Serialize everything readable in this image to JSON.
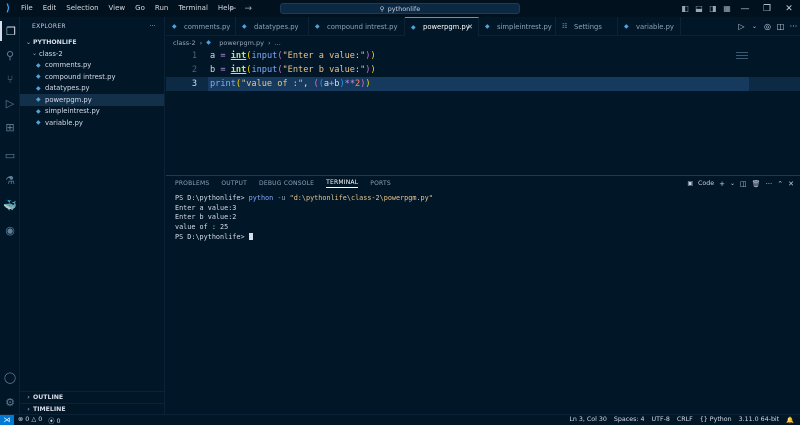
{
  "titlebar": {
    "menu": [
      "File",
      "Edit",
      "Selection",
      "View",
      "Go",
      "Run",
      "Terminal",
      "Help"
    ],
    "search_text": "pythonlife"
  },
  "explorer": {
    "title": "EXPLORER",
    "workspace": "PYTHONLIFE",
    "folder": "class-2",
    "files": [
      "comments.py",
      "compound intrest.py",
      "datatypes.py",
      "powerpgm.py",
      "simpleintrest.py",
      "variable.py"
    ],
    "selected": "powerpgm.py",
    "outline": "OUTLINE",
    "timeline": "TIMELINE"
  },
  "tabs": [
    {
      "label": "comments.py",
      "icon": "python-icon"
    },
    {
      "label": "datatypes.py",
      "icon": "python-icon"
    },
    {
      "label": "compound intrest.py",
      "icon": "python-icon"
    },
    {
      "label": "powerpgm.py",
      "icon": "python-icon",
      "active": true
    },
    {
      "label": "simpleintrest.py",
      "icon": "python-icon"
    },
    {
      "label": "Settings",
      "icon": "settings-icon"
    },
    {
      "label": "variable.py",
      "icon": "python-icon"
    }
  ],
  "breadcrumb": [
    "class-2",
    "powerpgm.py",
    "..."
  ],
  "editor": {
    "line_numbers": [
      "1",
      "2",
      "3"
    ],
    "line1": {
      "var": "a",
      "eq": " = ",
      "fn": "int",
      "p1": "(",
      "inp": "input",
      "p2": "(",
      "str": "\"Enter a value:\"",
      "p3": ")",
      "p4": ")"
    },
    "line2": {
      "var": "b",
      "eq": " = ",
      "fn": "int",
      "p1": "(",
      "inp": "input",
      "p2": "(",
      "str": "\"Enter b value:\"",
      "p3": ")",
      "p4": ")"
    },
    "line3": {
      "fn": "print",
      "p1": "(",
      "str": "\"value of :\"",
      "comma": ", ",
      "p2": "(",
      "p3": "(",
      "a": "a",
      "plus": "+",
      "b": "b",
      "p4": ")",
      "pow": "**",
      "num": "2",
      "p5": ")",
      "p6": ")"
    }
  },
  "panel": {
    "tabs": [
      "PROBLEMS",
      "OUTPUT",
      "DEBUG CONSOLE",
      "TERMINAL",
      "PORTS"
    ],
    "active_tab": "TERMINAL",
    "shell_label": "Code",
    "terminal": {
      "prompt1": "PS D:\\pythonlife> ",
      "cmd": "python",
      "arg": " -u ",
      "path": "\"d:\\pythonlife\\class-2\\powerpgm.py\"",
      "out1": "Enter a value:3",
      "out2": "Enter b value:2",
      "out3": "value of : 25",
      "prompt2": "PS D:\\pythonlife> "
    }
  },
  "statusbar": {
    "errors": "0",
    "warnings": "0",
    "ports": "0",
    "position": "Ln 3, Col 30",
    "spaces": "Spaces: 4",
    "encoding": "UTF-8",
    "eol": "CRLF",
    "language": "Python",
    "interpreter": "3.11.0 64-bit"
  }
}
